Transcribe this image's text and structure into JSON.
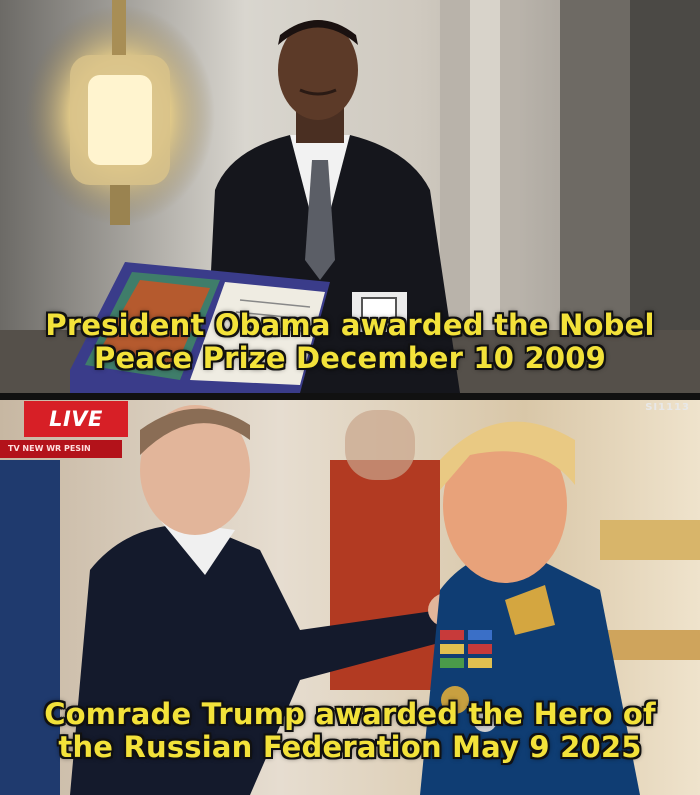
{
  "top_panel": {
    "caption_line1": "President Obama awarded the Nobel",
    "caption_line2": "Peace Prize December 10 2009"
  },
  "bottom_panel": {
    "caption_line1": "Comrade Trump awarded the Hero of",
    "caption_line2": "the Russian Federation May 9 2025",
    "live_badge": "LIVE",
    "ticker_text": "TV NEW WR PESIN",
    "channel_bug": "SI1113"
  },
  "colors": {
    "caption_text": "#f3e23a",
    "caption_outline": "#111111",
    "live_red": "#d71f26"
  }
}
